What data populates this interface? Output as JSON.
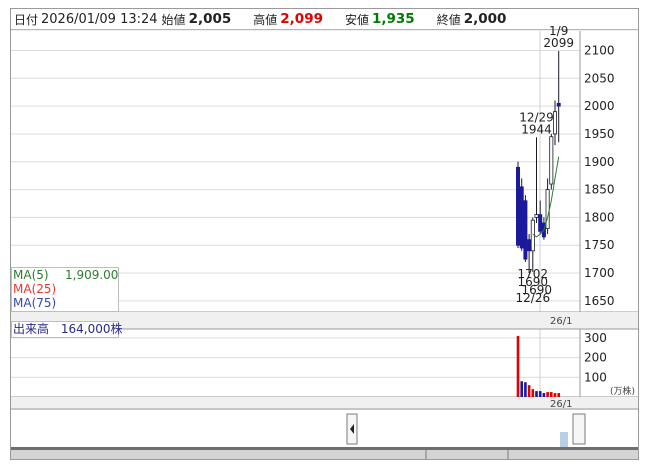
{
  "header": {
    "date_label": "日付",
    "datetime": "2026/01/09 13:24",
    "open_label": "始値",
    "open": "2,005",
    "open_color": "#000000",
    "high_label": "高値",
    "high": "2,099",
    "high_color": "#e00000",
    "low_label": "安値",
    "low": "1,935",
    "low_color": "#007a00",
    "close_label": "終値",
    "close": "2,000",
    "close_color": "#000000"
  },
  "legend": {
    "ma5_label": "MA(5)",
    "ma5_value": "1,909.00",
    "ma5_color": "#2e7d32",
    "ma25_label": "MA(25)",
    "ma25_color": "#e53935",
    "ma75_label": "MA(75)",
    "ma75_color": "#3949ab"
  },
  "volume": {
    "label": "出来高",
    "value": "164,000株",
    "unit": "(万株)"
  },
  "chart_data": [
    {
      "type": "candlestick",
      "y_ticks": [
        1650,
        1700,
        1750,
        1800,
        1850,
        1900,
        1950,
        2000,
        2050,
        2100
      ],
      "ylim": [
        1630,
        2135
      ],
      "x_tick_label": "26/1",
      "up_color": "#ffffff",
      "down_color": "#1a1a9a",
      "candles": [
        {
          "open": 1890,
          "high": 1900,
          "low": 1745,
          "close": 1750
        },
        {
          "open": 1855,
          "high": 1870,
          "low": 1740,
          "close": 1745
        },
        {
          "open": 1830,
          "high": 1840,
          "low": 1720,
          "close": 1725
        },
        {
          "open": 1760,
          "high": 1770,
          "low": 1700,
          "close": 1740
        },
        {
          "open": 1740,
          "high": 1800,
          "low": 1702,
          "close": 1795
        },
        {
          "open": 1800,
          "high": 1944,
          "low": 1790,
          "close": 1805
        },
        {
          "open": 1805,
          "high": 1830,
          "low": 1770,
          "close": 1775
        },
        {
          "open": 1790,
          "high": 1800,
          "low": 1760,
          "close": 1765
        },
        {
          "open": 1780,
          "high": 1870,
          "low": 1770,
          "close": 1850
        },
        {
          "open": 1860,
          "high": 1950,
          "low": 1850,
          "close": 1945
        },
        {
          "open": 1950,
          "high": 2010,
          "low": 1930,
          "close": 1990
        },
        {
          "open": 2005,
          "high": 2099,
          "low": 1935,
          "close": 2000
        }
      ],
      "ma5": [
        null,
        null,
        null,
        null,
        1770,
        1765,
        1770,
        1777,
        1800,
        1830,
        1870,
        1909
      ],
      "annotations": [
        {
          "candle": 11,
          "lines": [
            "1/9",
            "2099"
          ],
          "pos": "above"
        },
        {
          "candle": 5,
          "lines": [
            "12/29",
            "1944"
          ],
          "pos": "above"
        },
        {
          "candle": 4,
          "lines": [
            "1702",
            "1690",
            "1690",
            "12/26"
          ],
          "pos": "below"
        }
      ]
    },
    {
      "type": "bar",
      "name": "volume",
      "y_ticks": [
        100,
        200,
        300
      ],
      "ylim": [
        0,
        345
      ],
      "x_tick_label": "26/1",
      "values": [
        310,
        80,
        75,
        60,
        40,
        30,
        30,
        20,
        25,
        25,
        20,
        20
      ],
      "colors": [
        "#e00000",
        "#1a1a9a",
        "#1a1a9a",
        "#e00000",
        "#e00000",
        "#1a1a9a",
        "#1a1a9a",
        "#1a1a9a",
        "#e00000",
        "#e00000",
        "#e00000",
        "#e00000"
      ]
    }
  ]
}
